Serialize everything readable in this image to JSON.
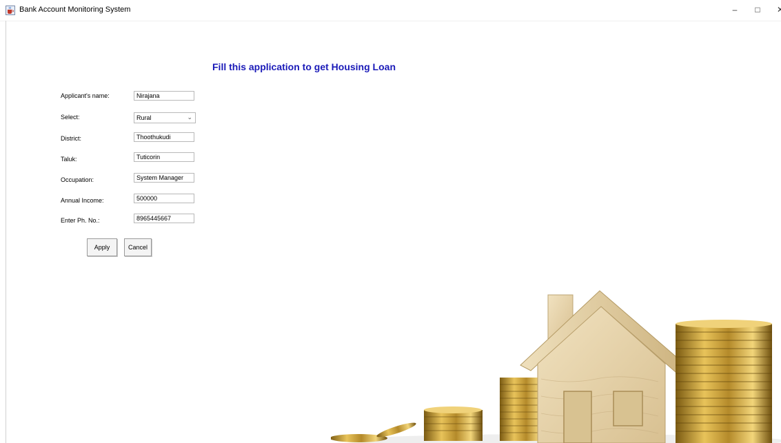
{
  "window": {
    "title": "Bank Account Monitoring System",
    "icons": {
      "app": "java-cup-icon",
      "minimize": "minimize-icon",
      "maximize": "maximize-icon",
      "close": "close-icon"
    }
  },
  "form": {
    "heading": "Fill this application to get Housing Loan",
    "labels": {
      "name": "Applicant's name:",
      "select": "Select:",
      "district": "District:",
      "taluk": "Taluk:",
      "occupation": "Occupation:",
      "income": "Annual Income:",
      "phone": "Enter Ph. No.:"
    },
    "values": {
      "name": "Nirajana",
      "select": "Rural",
      "district": "Thoothukudi",
      "taluk": "Tuticorin",
      "occupation": "System Manager",
      "income": "500000",
      "phone": "8965445667"
    },
    "buttons": {
      "apply": "Apply",
      "cancel": "Cancel"
    }
  },
  "illustration": {
    "subject": "house-and-gold-coins-image"
  }
}
